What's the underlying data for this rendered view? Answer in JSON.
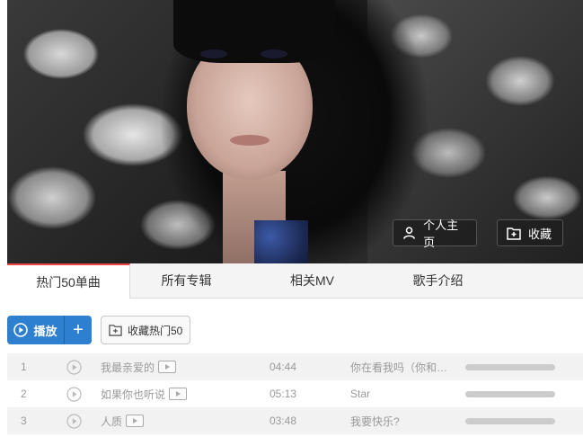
{
  "banner": {
    "profile_button": "个人主页",
    "favorite_button": "收藏"
  },
  "tabs": [
    {
      "label": "热门50单曲",
      "active": true
    },
    {
      "label": "所有专辑",
      "active": false
    },
    {
      "label": "相关MV",
      "active": false
    },
    {
      "label": "歌手介绍",
      "active": false
    }
  ],
  "toolbar": {
    "play_label": "播放",
    "add_label": "+",
    "fav_label": "收藏热门50"
  },
  "songs": [
    {
      "num": "1",
      "title": "我最亲爱的",
      "duration": "04:44",
      "album": "你在看我吗（你和…",
      "popularity": 1.0
    },
    {
      "num": "2",
      "title": "如果你也听说",
      "duration": "05:13",
      "album": "Star",
      "popularity": 1.0
    },
    {
      "num": "3",
      "title": "人质",
      "duration": "03:48",
      "album": "我要快乐?",
      "popularity": 1.0
    }
  ],
  "colors": {
    "accent": "#2d7fd0",
    "tab_indicator": "#e44444"
  }
}
